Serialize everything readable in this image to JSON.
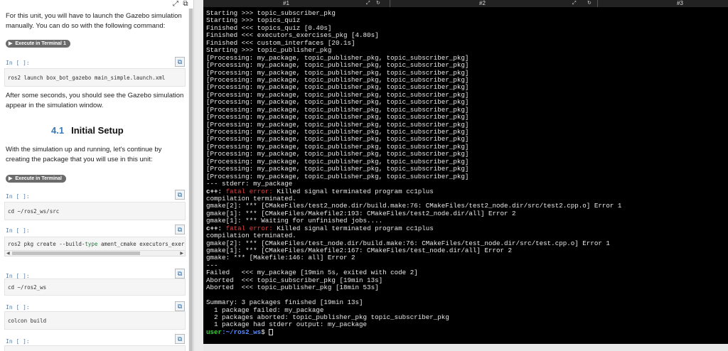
{
  "notebook": {
    "para1": "For this unit, you will have to launch the Gazebo simulation manually. You can do so with the following command:",
    "run1": "Execute in Terminal 1",
    "cell_label": "In [ ]:",
    "cmd1": "ros2 launch box_bot_gazebo main_simple.launch.xml",
    "para2": "After some seconds, you should see the Gazebo simulation appear in the simulation window.",
    "heading_num": "4.1",
    "heading_text": "Initial Setup",
    "para3": "With the simulation up and running, let's continue by creating the package that you will use in this unit:",
    "run2": "Execute in Terminal",
    "cmd2": "cd ~/ros2_ws/src",
    "cmd3_pre": "ros2 pkg create --build-",
    "cmd3_kw": "type",
    "cmd3_post": " ament_cmake executors_exerc",
    "cmd4": "cd ~/ros2_ws",
    "cmd5": "colcon build"
  },
  "tabs": [
    {
      "label": "#1"
    },
    {
      "label": "#2"
    },
    {
      "label": "#3"
    }
  ],
  "terminal": {
    "lines": [
      "Starting >>> topic_subscriber_pkg",
      "Starting >>> topics_quiz",
      "Finished <<< topics_quiz [0.40s]",
      "Finished <<< executors_exercises_pkg [4.80s]",
      "Finished <<< custom_interfaces [20.1s]",
      "Starting >>> topic_publisher_pkg",
      "[Processing: my_package, topic_publisher_pkg, topic_subscriber_pkg]",
      "[Processing: my_package, topic_publisher_pkg, topic_subscriber_pkg]",
      "[Processing: my_package, topic_publisher_pkg, topic_subscriber_pkg]",
      "[Processing: my_package, topic_publisher_pkg, topic_subscriber_pkg]",
      "[Processing: my_package, topic_publisher_pkg, topic_subscriber_pkg]",
      "[Processing: my_package, topic_publisher_pkg, topic_subscriber_pkg]",
      "[Processing: my_package, topic_publisher_pkg, topic_subscriber_pkg]",
      "[Processing: my_package, topic_publisher_pkg, topic_subscriber_pkg]",
      "[Processing: my_package, topic_publisher_pkg, topic_subscriber_pkg]",
      "[Processing: my_package, topic_publisher_pkg, topic_subscriber_pkg]",
      "[Processing: my_package, topic_publisher_pkg, topic_subscriber_pkg]",
      "[Processing: my_package, topic_publisher_pkg, topic_subscriber_pkg]",
      "[Processing: my_package, topic_publisher_pkg, topic_subscriber_pkg]",
      "[Processing: my_package, topic_publisher_pkg, topic_subscriber_pkg]",
      "[Processing: my_package, topic_publisher_pkg, topic_subscriber_pkg]",
      "[Processing: my_package, topic_publisher_pkg, topic_subscriber_pkg]",
      "[Processing: my_package, topic_publisher_pkg, topic_subscriber_pkg]",
      "--- stderr: my_package",
      "c++: |fatal error:| Killed signal terminated program cc1plus",
      "compilation terminated.",
      "gmake[2]: *** [CMakeFiles/test2_node.dir/build.make:76: CMakeFiles/test2_node.dir/src/test2.cpp.o] Error 1",
      "gmake[1]: *** [CMakeFiles/Makefile2:193: CMakeFiles/test2_node.dir/all] Error 2",
      "gmake[1]: *** Waiting for unfinished jobs....",
      "c++: |fatal error:| Killed signal terminated program cc1plus",
      "compilation terminated.",
      "gmake[2]: *** [CMakeFiles/test_node.dir/build.make:76: CMakeFiles/test_node.dir/src/test.cpp.o] Error 1",
      "gmake[1]: *** [CMakeFiles/Makefile2:167: CMakeFiles/test_node.dir/all] Error 2",
      "gmake: *** [Makefile:146: all] Error 2",
      "---",
      "Failed   <<< my_package [19min 5s, exited with code 2]",
      "Aborted  <<< topic_subscriber_pkg [19min 13s]",
      "Aborted  <<< topic_publisher_pkg [18min 53s]",
      "",
      "Summary: 3 packages finished [19min 13s]",
      "  1 package failed: my_package",
      "  2 packages aborted: topic_publisher_pkg topic_subscriber_pkg",
      "  1 package had stderr output: my_package"
    ],
    "prompt_user": "user",
    "prompt_path": ":~/ros2_ws",
    "prompt_symbol": "$ ",
    "colors": {
      "bg": "#000000",
      "text": "#e8e8e8",
      "error": "#e04040",
      "user": "#38d038",
      "path": "#5a8cff"
    }
  },
  "icons": [
    "external-link-icon",
    "expand-icon",
    "play-icon",
    "copy-icon",
    "refresh-icon"
  ]
}
